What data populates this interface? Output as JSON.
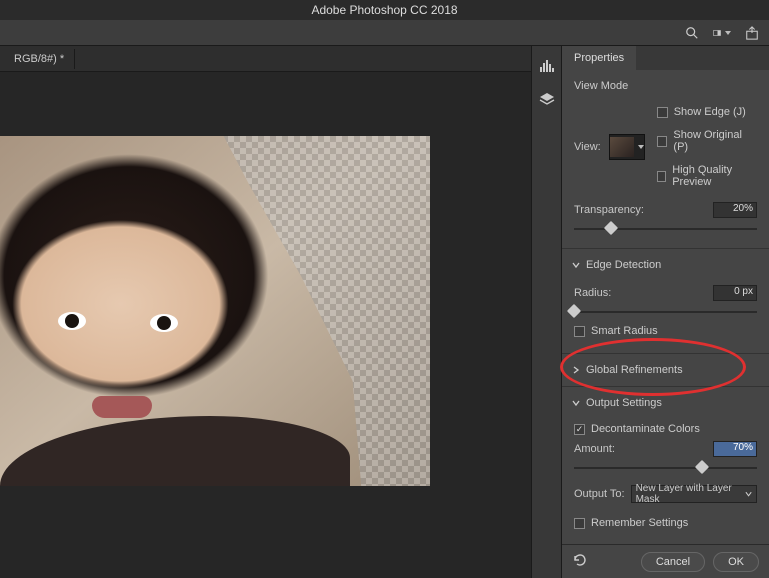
{
  "app": {
    "title": "Adobe Photoshop CC 2018"
  },
  "document": {
    "tab_label": "RGB/8#) *"
  },
  "panel": {
    "tab": "Properties",
    "view_mode": {
      "header": "View Mode",
      "view_label": "View:",
      "show_edge": "Show Edge (J)",
      "show_original": "Show Original (P)",
      "high_quality": "High Quality Preview",
      "transparency_label": "Transparency:",
      "transparency_value": "20%",
      "transparency_pct": 20
    },
    "edge_detection": {
      "header": "Edge Detection",
      "radius_label": "Radius:",
      "radius_value": "0 px",
      "radius_pct": 0,
      "smart_radius": "Smart Radius"
    },
    "global_refinements": {
      "header": "Global Refinements"
    },
    "output_settings": {
      "header": "Output Settings",
      "decontaminate": "Decontaminate Colors",
      "amount_label": "Amount:",
      "amount_value": "70%",
      "amount_pct": 70,
      "output_to_label": "Output To:",
      "output_to_value": "New Layer with Layer Mask",
      "remember": "Remember Settings"
    },
    "footer": {
      "cancel": "Cancel",
      "ok": "OK"
    }
  },
  "icons": {
    "search": "search-icon",
    "frame": "frame-icon",
    "share": "share-icon",
    "histogram": "histogram-icon",
    "layers": "layers-icon",
    "reset": "reset-icon"
  }
}
